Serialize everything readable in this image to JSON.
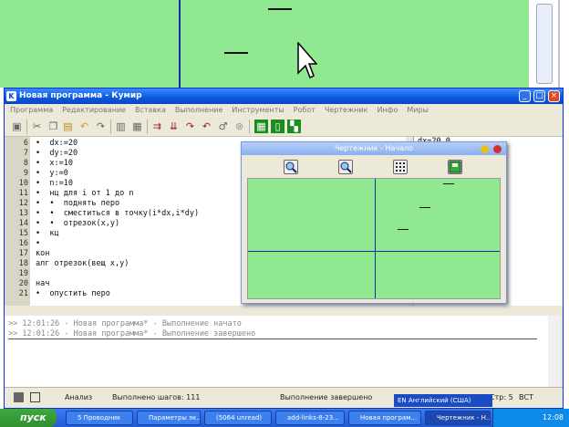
{
  "window": {
    "title": "Новая программа - Кумир",
    "icon": "K"
  },
  "menu": [
    "Программа",
    "Редактирование",
    "Вставка",
    "Выполнение",
    "Инструменты",
    "Робот",
    "Чертежник",
    "Инфо",
    "Миры"
  ],
  "code": [
    {
      "n": "6",
      "t": "•  dx:=20"
    },
    {
      "n": "7",
      "t": "•  dy:=20"
    },
    {
      "n": "8",
      "t": "•  x:=10"
    },
    {
      "n": "9",
      "t": "•  y:=0"
    },
    {
      "n": "10",
      "t": "•  n:=10"
    },
    {
      "n": "11",
      "t": "•  нц для i от 1 до n"
    },
    {
      "n": "12",
      "t": "•  •  поднять перо"
    },
    {
      "n": "13",
      "t": "•  •  сместиться в точку(i*dx,i*dy)"
    },
    {
      "n": "14",
      "t": "•  •  отрезок(x,y)"
    },
    {
      "n": "15",
      "t": "•  кц"
    },
    {
      "n": "16",
      "t": "•"
    },
    {
      "n": "17",
      "t": "кон"
    },
    {
      "n": "18",
      "t": "алг отрезок(вещ x,y)"
    },
    {
      "n": "19",
      "t": ""
    },
    {
      "n": "20",
      "t": "нач"
    },
    {
      "n": "21",
      "t": "•  опустить перо"
    }
  ],
  "result": "dx=20.0",
  "drawing": {
    "title": "Чертежник - Начало"
  },
  "messages": [
    ">> 12:01:26 - Новая программа* - Выполнение начато",
    ">> 12:01:26 - Новая программа* - Выполнение завершено"
  ],
  "status": {
    "mode": "Анализ",
    "steps": "Выполнено шагов: 111",
    "state": "Выполнение завершено",
    "pos": "Стр: 5",
    "ins": "ВСТ"
  },
  "langbar": "EN Английский (США)",
  "taskbar": {
    "start": "пуск",
    "tasks": [
      "5 Проводник",
      "Параметры эк...",
      "(5064 unread)",
      "add-links-8-23...",
      "Новая програм...",
      "Чертежник - Н..."
    ],
    "clock": "12:08"
  }
}
